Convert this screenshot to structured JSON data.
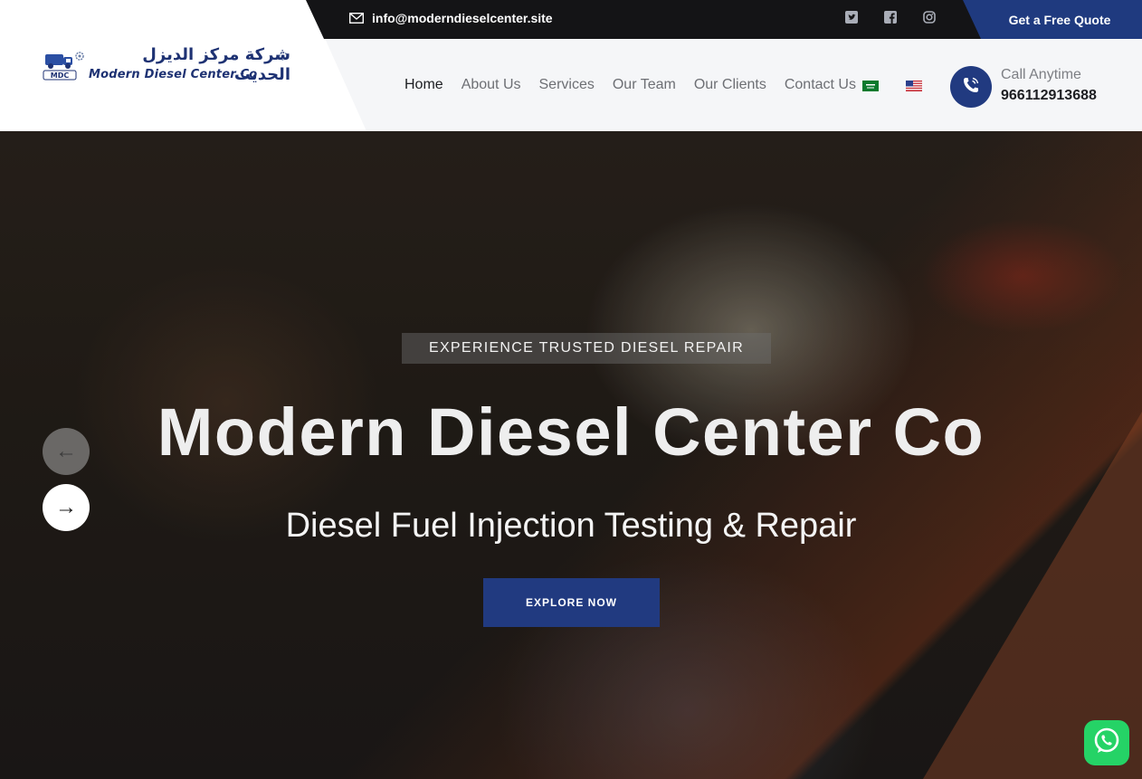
{
  "topbar": {
    "email": "info@moderndieselcenter.site",
    "social": [
      "twitter-icon",
      "facebook-icon",
      "instagram-icon"
    ],
    "quote_label": "Get a Free Quote"
  },
  "logo": {
    "arabic": "شركة مركز الديزل الحديث",
    "english": "Modern Diesel Center Co",
    "badge": "MDC"
  },
  "nav": {
    "items": [
      {
        "label": "Home",
        "active": true
      },
      {
        "label": "About Us"
      },
      {
        "label": "Services"
      },
      {
        "label": "Our Team"
      },
      {
        "label": "Our Clients"
      },
      {
        "label": "Contact Us"
      }
    ],
    "flags": [
      "saudi-flag-icon",
      "us-flag-icon"
    ]
  },
  "call": {
    "label": "Call Anytime",
    "number": "966112913688"
  },
  "hero": {
    "tagline": "EXPERIENCE TRUSTED DIESEL REPAIR",
    "title": "Modern Diesel Center Co",
    "subtitle": "Diesel Fuel Injection Testing & Repair",
    "button": "EXPLORE NOW",
    "prev_arrow": "←",
    "next_arrow": "→"
  },
  "colors": {
    "brand_blue": "#213a80",
    "topbar_dark": "#141416",
    "whatsapp_green": "#25d366"
  }
}
